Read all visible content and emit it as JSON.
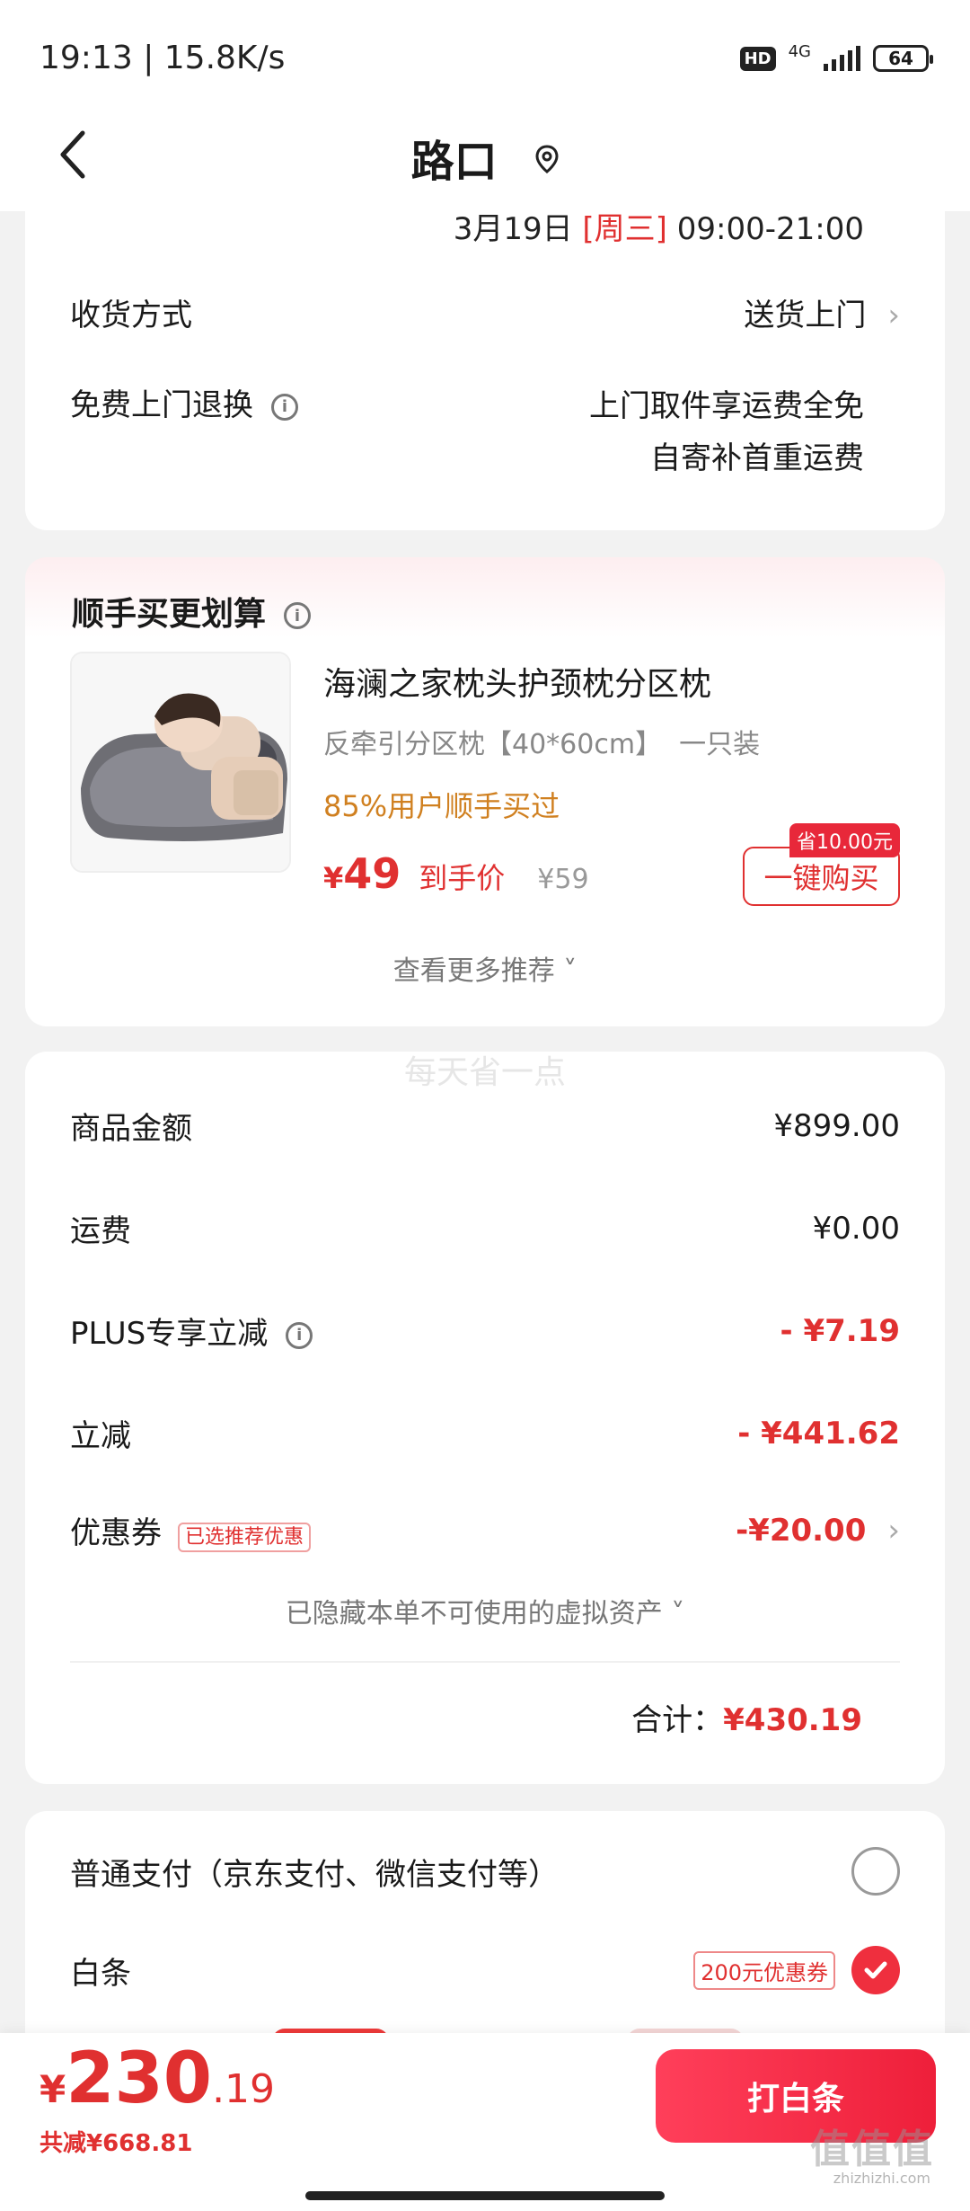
{
  "status_bar": {
    "time": "19:13 | 15.8K/s",
    "hd": "HD",
    "network": "4G",
    "battery": "64"
  },
  "nav": {
    "title": "路口",
    "back_icon": "chevron-left-icon",
    "location_icon": "location-pin-icon"
  },
  "delivery": {
    "time_prefix": "3月19日",
    "time_day": "[周三]",
    "time_suffix": "09:00-21:00",
    "method_label": "收货方式",
    "method_value": "送货上门",
    "return_label": "免费上门退换",
    "return_line1": "上门取件享运费全免",
    "return_line2": "自寄补首重运费"
  },
  "recommend": {
    "title": "顺手买更划算",
    "product_name": "海澜之家枕头护颈枕分区枕",
    "product_spec": "反牵引分区枕【40*60cm】  一只装",
    "bought": "85%用户顺手买过",
    "price_symbol": "¥",
    "price": "49",
    "price_label": "到手价",
    "orig_price": "¥59",
    "save_badge": "省10.00元",
    "buy_button": "一键购买",
    "more_link": "查看更多推荐 ˅"
  },
  "summary": {
    "goods_label": "商品金额",
    "goods_value": "¥899.00",
    "shipping_label": "运费",
    "shipping_value": "¥0.00",
    "plus_label": "PLUS专享立减",
    "plus_value": "- ¥7.19",
    "discount_label": "立减",
    "discount_value": "- ¥441.62",
    "coupon_label": "优惠券",
    "coupon_tag": "已选推荐优惠",
    "coupon_value": "-¥20.00",
    "hidden_assets": "已隐藏本单不可使用的虚拟资产 ˅",
    "total_label": "合计：",
    "total_value": "¥430.19",
    "watermark": "每天省一点"
  },
  "payment": {
    "option1_label": "普通支付（京东支付、微信支付等）",
    "option2_label": "白条",
    "option2_coupon": "200元优惠券"
  },
  "bottom": {
    "price_symbol": "¥",
    "price_int": "230",
    "price_dec": ".19",
    "saved": "共减¥668.81",
    "pay_button": "打白条",
    "watermark": "值值值",
    "watermark_url": "zhizhizhi.com"
  },
  "colors": {
    "accent": "#e03030",
    "pay_button": "#ee1f3a",
    "bought_text": "#d08020"
  }
}
